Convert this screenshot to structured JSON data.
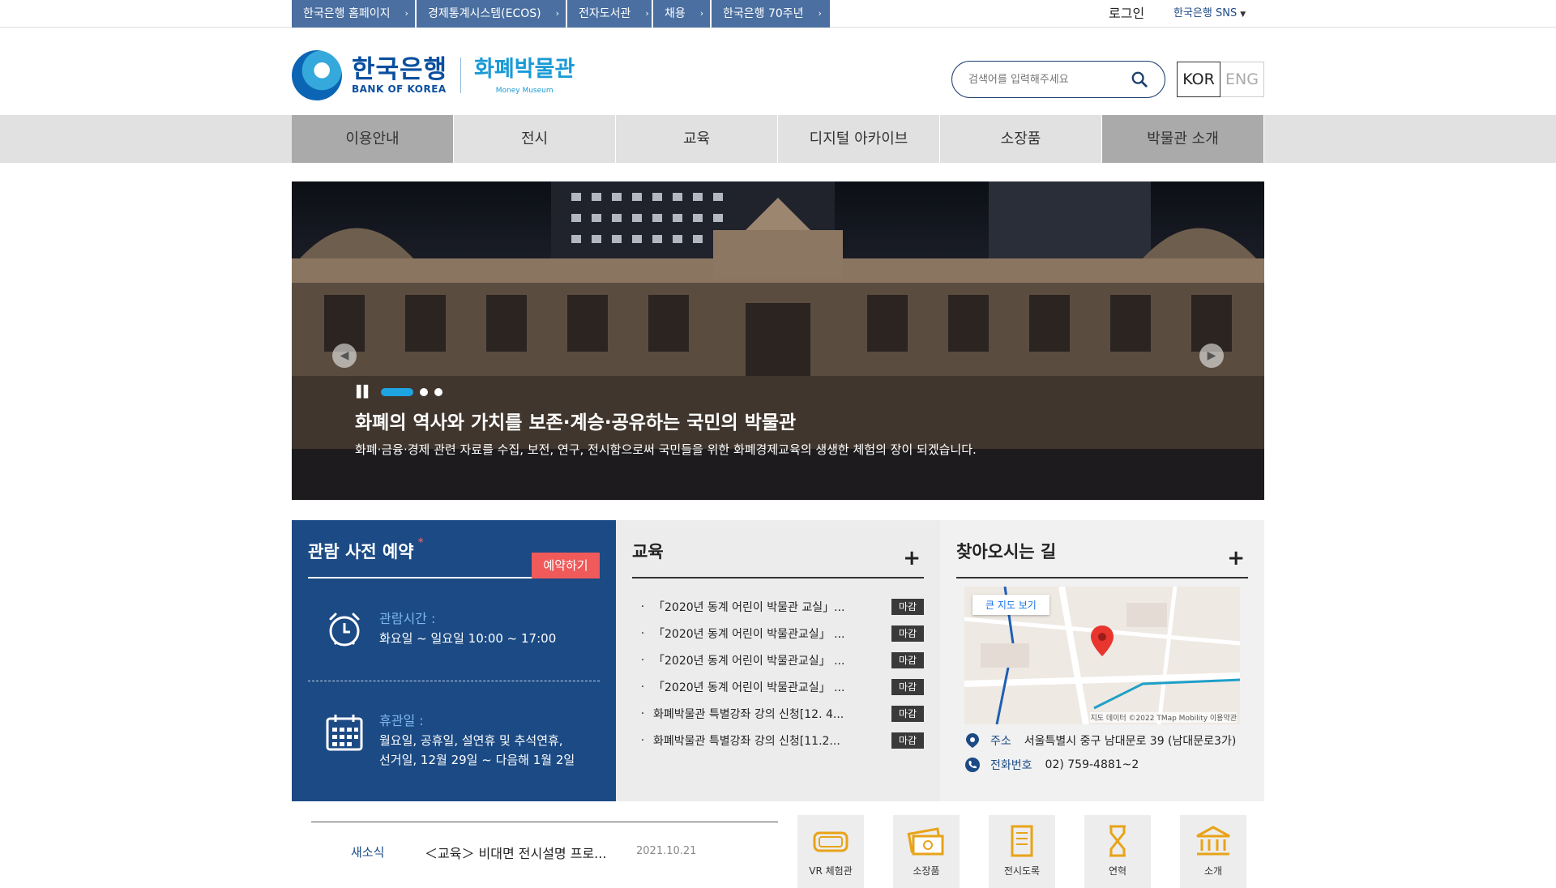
{
  "topbar": {
    "links": [
      {
        "label": "한국은행 홈페이지"
      },
      {
        "label": "경제통계시스템(ECOS)"
      },
      {
        "label": "전자도서관"
      },
      {
        "label": "채용"
      },
      {
        "label": "한국은행 70주년"
      }
    ],
    "login": "로그인",
    "sns": "한국은행 SNS"
  },
  "header": {
    "logo_ko": "한국은행",
    "logo_en": "BANK OF KOREA",
    "museum_ko": "화폐박물관",
    "museum_en": "Money Museum",
    "search_placeholder": "검색어를 입력해주세요",
    "lang_kor": "KOR",
    "lang_eng": "ENG"
  },
  "gnb": [
    {
      "label": "이용안내"
    },
    {
      "label": "전시"
    },
    {
      "label": "교육"
    },
    {
      "label": "디지털 아카이브"
    },
    {
      "label": "소장품"
    },
    {
      "label": "박물관 소개"
    }
  ],
  "hero": {
    "title": "화폐의 역사와 가치를 보존·계승·공유하는 국민의 박물관",
    "subtitle": "화폐·금융·경제 관련 자료를 수집, 보전, 연구, 전시함으로써 국민들을 위한 화폐경제교육의 생생한 체험의 장이 되겠습니다."
  },
  "reservation": {
    "title": "관람 사전 예약",
    "star": "*",
    "button": "예약하기",
    "hours_label": "관람시간 :",
    "hours_text": "화요일 ~ 일요일 10:00 ~ 17:00",
    "closed_label": "휴관일 :",
    "closed_line1": "월요일, 공휴일, 설연휴 및 추석연휴,",
    "closed_line2": "선거일, 12월 29일 ~ 다음해 1월 2일"
  },
  "education": {
    "title": "교육",
    "more": "+",
    "items": [
      {
        "text": "「2020년 동계 어린이 박물관 교실」...",
        "status": "마감"
      },
      {
        "text": "「2020년 동계 어린이 박물관교실」 ...",
        "status": "마감"
      },
      {
        "text": "「2020년 동계 어린이 박물관교실」 ...",
        "status": "마감"
      },
      {
        "text": "「2020년 동계 어린이 박물관교실」 ...",
        "status": "마감"
      },
      {
        "text": "화폐박물관 특별강좌 강의 신청[12. 4...",
        "status": "마감"
      },
      {
        "text": "화폐박물관 특별강좌 강의 신청[11.2...",
        "status": "마감"
      }
    ]
  },
  "directions": {
    "title": "찾아오시는 길",
    "more": "+",
    "map_button": "큰 지도 보기",
    "map_credit": "지도 데이터 ©2022 TMap Mobility   이용약관",
    "address_label": "주소",
    "address": "서울특별시 중구 남대문로 39 (남대문로3가)",
    "phone_label": "전화번호",
    "phone": "02) 759-4881~2"
  },
  "news": {
    "label": "새소식",
    "title": "＜교육＞ 비대면 전시설명 프로...",
    "date": "2021.10.21"
  },
  "quick_links": [
    {
      "label": "VR 체험관",
      "icon": "vr-goggles-icon"
    },
    {
      "label": "소장품",
      "icon": "money-icon"
    },
    {
      "label": "전시도록",
      "icon": "book-icon"
    },
    {
      "label": "연혁",
      "icon": "hourglass-icon"
    },
    {
      "label": "소개",
      "icon": "bank-icon"
    }
  ],
  "colors": {
    "accent_blue": "#1b4a84",
    "top_link_bg": "#4a6fa0",
    "reserve_btn": "#f05a5a",
    "slider_active": "#1ea4e0"
  }
}
